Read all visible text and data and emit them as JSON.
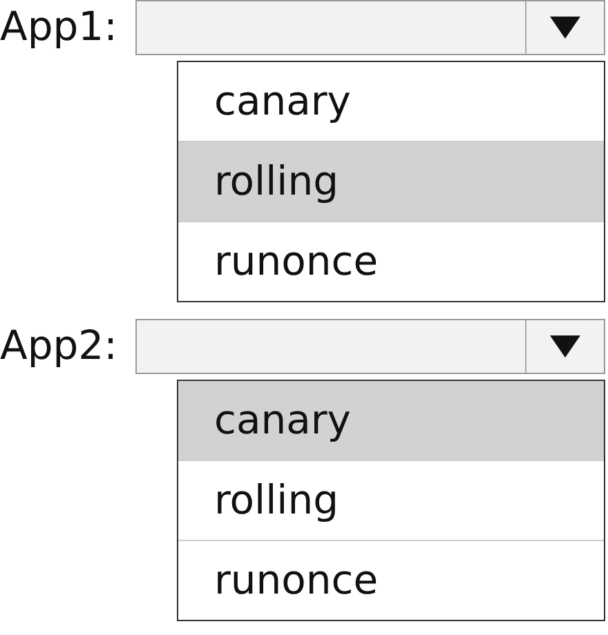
{
  "dropdowns": [
    {
      "label": "App1:",
      "expanded": true,
      "options": [
        {
          "label": "canary",
          "selected": false
        },
        {
          "label": "rolling",
          "selected": true
        },
        {
          "label": "runonce",
          "selected": false
        }
      ]
    },
    {
      "label": "App2:",
      "expanded": true,
      "options": [
        {
          "label": "canary",
          "selected": true
        },
        {
          "label": "rolling",
          "selected": false
        },
        {
          "label": "runonce",
          "selected": false
        }
      ]
    }
  ]
}
